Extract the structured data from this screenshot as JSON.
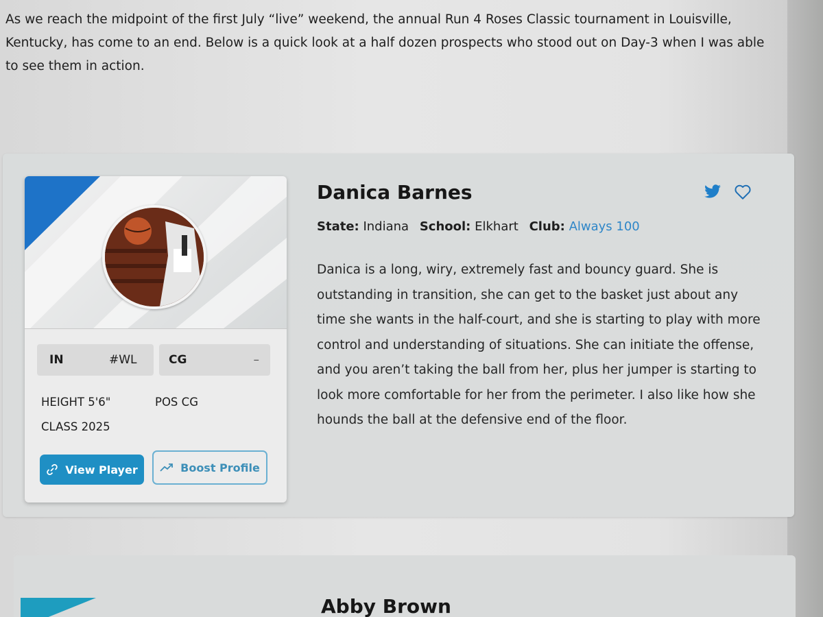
{
  "intro": "As we reach the midpoint of the first July “live” weekend, the annual Run 4 Roses Classic tournament in Louisville, Kentucky, has come to an end. Below is a quick look at a half dozen prospects who stood out on Day-3 when I was able to see them in action.",
  "player": {
    "name": "Danica Barnes",
    "state_label": "State:",
    "state": "Indiana",
    "school_label": "School:",
    "school": "Elkhart",
    "club_label": "Club:",
    "club": "Always 100",
    "description": "Danica is a long, wiry, extremely fast and bouncy guard. She is outstanding in transition, she can get to the basket just about any time she wants in the half-court, and she is starting to play with more control and understanding of situations. She can initiate the offense, and you aren’t taking the ball from her, plus her jumper is starting to look more comfortable for her from the perimeter. I also like how she hounds the ball at the defensive end of the floor.",
    "tags": {
      "state_abbr": "IN",
      "number": "#WL",
      "position": "CG",
      "extra": "–"
    },
    "stats": {
      "height_label": "HEIGHT",
      "height": "5'6\"",
      "pos_label": "POS",
      "pos": "CG",
      "class_label": "CLASS",
      "class": "2025"
    },
    "buttons": {
      "view": "View Player",
      "boost": "Boost Profile"
    },
    "icons": {
      "twitter": "twitter-icon",
      "favorite": "heart-icon",
      "link": "link-icon",
      "trend": "trending-up-icon"
    }
  },
  "next_player": {
    "name": "Abby Brown"
  },
  "colors": {
    "accent_blue": "#1f8fc4",
    "link_blue": "#2e86c8",
    "banner_blue": "#1e73c8",
    "next_banner": "#1e9dbf"
  }
}
